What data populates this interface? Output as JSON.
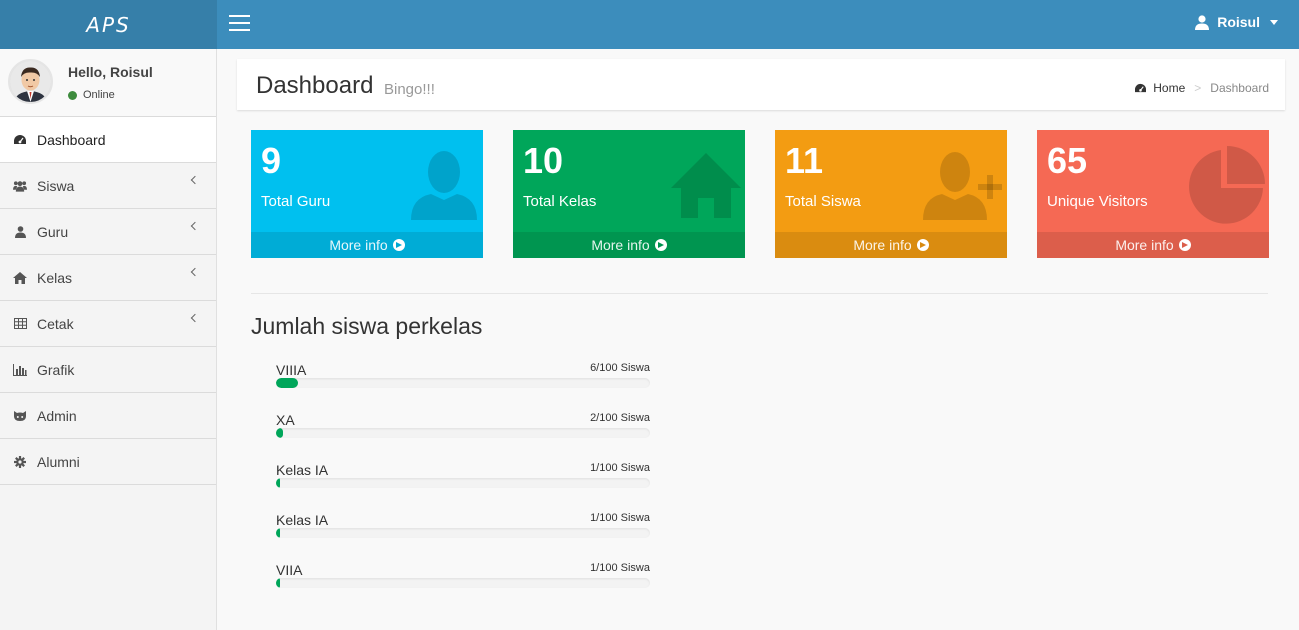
{
  "app": {
    "logo": "APS",
    "user_name": "Roisul"
  },
  "colors": {
    "topbar": "#3c8dbc",
    "logo_bg": "#367fa9",
    "aqua": "#00c0ef",
    "green": "#00a65a",
    "yellow": "#f39c12",
    "red": "#f56954"
  },
  "sidebar": {
    "hello": "Hello, Roisul",
    "status": "Online",
    "items": [
      {
        "label": "Dashboard",
        "icon": "dashboard-icon",
        "active": true,
        "has_submenu": false
      },
      {
        "label": "Siswa",
        "icon": "users-icon",
        "active": false,
        "has_submenu": true
      },
      {
        "label": "Guru",
        "icon": "user-icon",
        "active": false,
        "has_submenu": true
      },
      {
        "label": "Kelas",
        "icon": "home-icon",
        "active": false,
        "has_submenu": true
      },
      {
        "label": "Cetak",
        "icon": "table-icon",
        "active": false,
        "has_submenu": true
      },
      {
        "label": "Grafik",
        "icon": "bar-chart-icon",
        "active": false,
        "has_submenu": false
      },
      {
        "label": "Admin",
        "icon": "github-icon",
        "active": false,
        "has_submenu": false
      },
      {
        "label": "Alumni",
        "icon": "gear-icon",
        "active": false,
        "has_submenu": false
      }
    ]
  },
  "header": {
    "title": "Dashboard",
    "subtitle": "Bingo!!!",
    "breadcrumb": {
      "home": "Home",
      "separator": ">",
      "current": "Dashboard"
    }
  },
  "boxes": [
    {
      "number": "9",
      "label": "Total Guru",
      "footer": "More info",
      "icon": "user-icon"
    },
    {
      "number": "10",
      "label": "Total Kelas",
      "footer": "More info",
      "icon": "home-icon"
    },
    {
      "number": "11",
      "label": "Total Siswa",
      "footer": "More info",
      "icon": "user-plus-icon"
    },
    {
      "number": "65",
      "label": "Unique Visitors",
      "footer": "More info",
      "icon": "pie-chart-icon"
    }
  ],
  "section": {
    "title": "Jumlah siswa perkelas",
    "rows": [
      {
        "label": "VIIIA",
        "value_text": "6/100 Siswa",
        "value": 6
      },
      {
        "label": "XA",
        "value_text": "2/100 Siswa",
        "value": 2
      },
      {
        "label": "Kelas IA",
        "value_text": "1/100 Siswa",
        "value": 1
      },
      {
        "label": "Kelas IA",
        "value_text": "1/100 Siswa",
        "value": 1
      },
      {
        "label": "VIIA",
        "value_text": "1/100 Siswa",
        "value": 1
      }
    ]
  }
}
